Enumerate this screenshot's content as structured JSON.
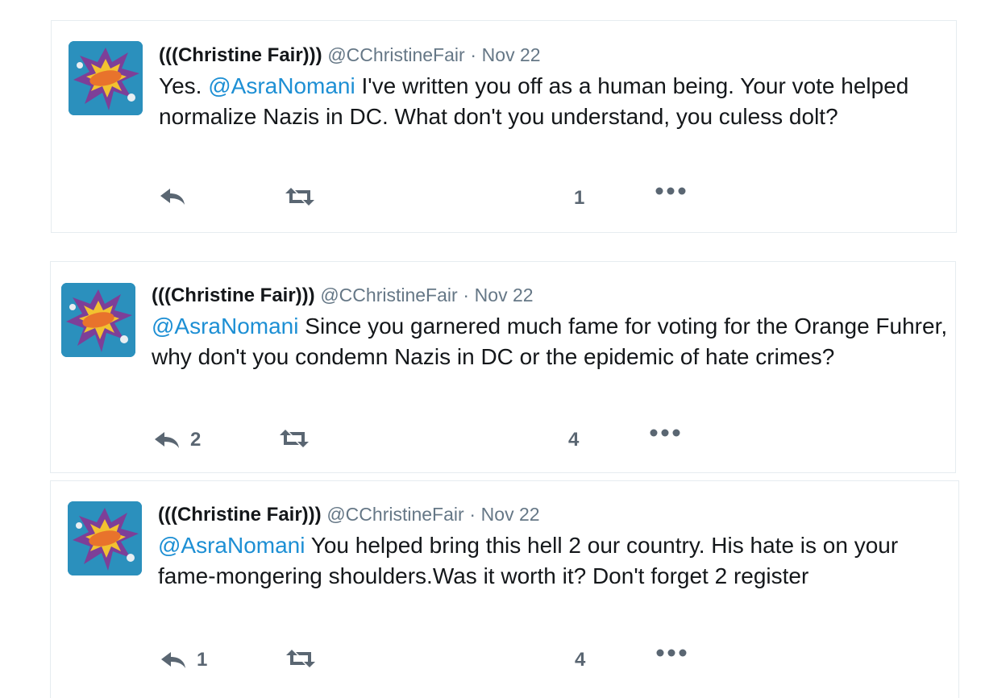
{
  "colors": {
    "mention": "#1d8fd4",
    "muted": "#657786",
    "action": "#5a6672",
    "avatar_bg": "#2b90bd"
  },
  "icons": {
    "reply": "reply-icon",
    "retweet": "retweet-icon",
    "more": "more-dots-icon"
  },
  "tweets": [
    {
      "name": "(((Christine Fair)))",
      "handle": "@CChristineFair",
      "separator": "·",
      "date": "Nov 22",
      "text_prefix": "Yes. ",
      "mention": "@AsraNomani",
      "text_rest": " I've written you off as a human being. Your vote helped normalize Nazis in DC. What don't you understand, you culess dolt?",
      "reply_count": "",
      "like_count": "1"
    },
    {
      "name": "(((Christine Fair)))",
      "handle": "@CChristineFair",
      "separator": "·",
      "date": "Nov 22",
      "text_prefix": "",
      "mention": "@AsraNomani",
      "text_rest": " Since you garnered much fame for voting for the Orange Fuhrer, why don't you condemn Nazis in DC or the epidemic of hate crimes?",
      "reply_count": "2",
      "like_count": "4"
    },
    {
      "name": "(((Christine Fair)))",
      "handle": "@CChristineFair",
      "separator": "·",
      "date": "Nov 22",
      "text_prefix": "",
      "mention": "@AsraNomani",
      "text_rest": " You helped bring this hell 2 our country. His hate is on your fame-mongering shoulders.Was it worth it?  Don't forget 2 register",
      "reply_count": "1",
      "like_count": "4"
    }
  ]
}
